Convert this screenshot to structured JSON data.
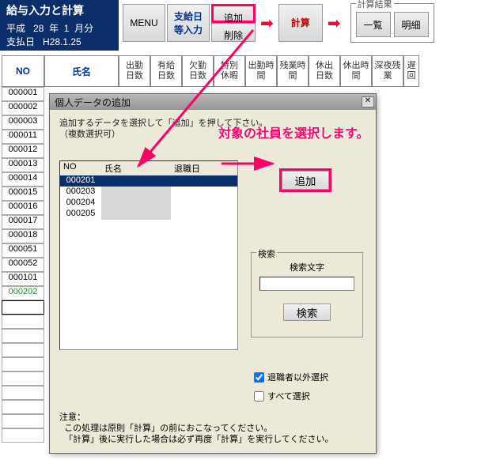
{
  "banner": {
    "title": "給与入力と計算",
    "era": "平成",
    "year": "28",
    "year_label": "年",
    "month": "1",
    "month_label": "月分",
    "pay_label": "支払日",
    "pay_date": "H28.1.25"
  },
  "toolbar": {
    "menu": "MENU",
    "supply_line1": "支給日",
    "supply_line2": "等入力",
    "add": "追加",
    "del": "削除",
    "calc": "計算",
    "result_label": "計算結果",
    "list": "一覧",
    "detail": "明細"
  },
  "grid": {
    "headers": {
      "no": "NO",
      "name": "氏名",
      "cols": [
        [
          "出勤",
          "日数"
        ],
        [
          "有給",
          "日数"
        ],
        [
          "欠勤",
          "日数"
        ],
        [
          "特別",
          "休暇"
        ],
        [
          "出勤時",
          "間"
        ],
        [
          "残業時",
          "間"
        ],
        [
          "休出",
          "日数"
        ],
        [
          "休出時",
          "間"
        ],
        [
          "深夜残",
          "業"
        ],
        [
          "遅",
          "回"
        ]
      ]
    },
    "rows": [
      {
        "no": "000001"
      },
      {
        "no": "000002"
      },
      {
        "no": "000003"
      },
      {
        "no": "000011"
      },
      {
        "no": "000012"
      },
      {
        "no": "000013"
      },
      {
        "no": "000014"
      },
      {
        "no": "000015"
      },
      {
        "no": "000016"
      },
      {
        "no": "000017"
      },
      {
        "no": "000018"
      },
      {
        "no": "000051"
      },
      {
        "no": "000052"
      },
      {
        "no": "000101"
      },
      {
        "no": "000202",
        "green": true
      }
    ]
  },
  "dialog": {
    "title": "個人データの追加",
    "close": "✕",
    "instr1": "追加するデータを選択して「追加」を押して下さい。",
    "instr2": "（複数選択可）",
    "list_headers": {
      "no": "NO",
      "name": "氏名",
      "ret": "退職日"
    },
    "list_rows": [
      {
        "no": "000201",
        "selected": true
      },
      {
        "no": "000203"
      },
      {
        "no": "000204"
      },
      {
        "no": "000205"
      }
    ],
    "add_btn": "追加",
    "search": {
      "frame_label": "検索",
      "sub_label": "検索文字",
      "value": "",
      "btn": "検索"
    },
    "chk1": "退職者以外選択",
    "chk2": "すべて選択",
    "note_title": "注意：",
    "note1": "この処理は原則「計算」の前におこなってください。",
    "note2": "「計算」後に実行した場合は必ず再度「計算」を実行してください。"
  },
  "annotation": "対象の社員を選択します。"
}
